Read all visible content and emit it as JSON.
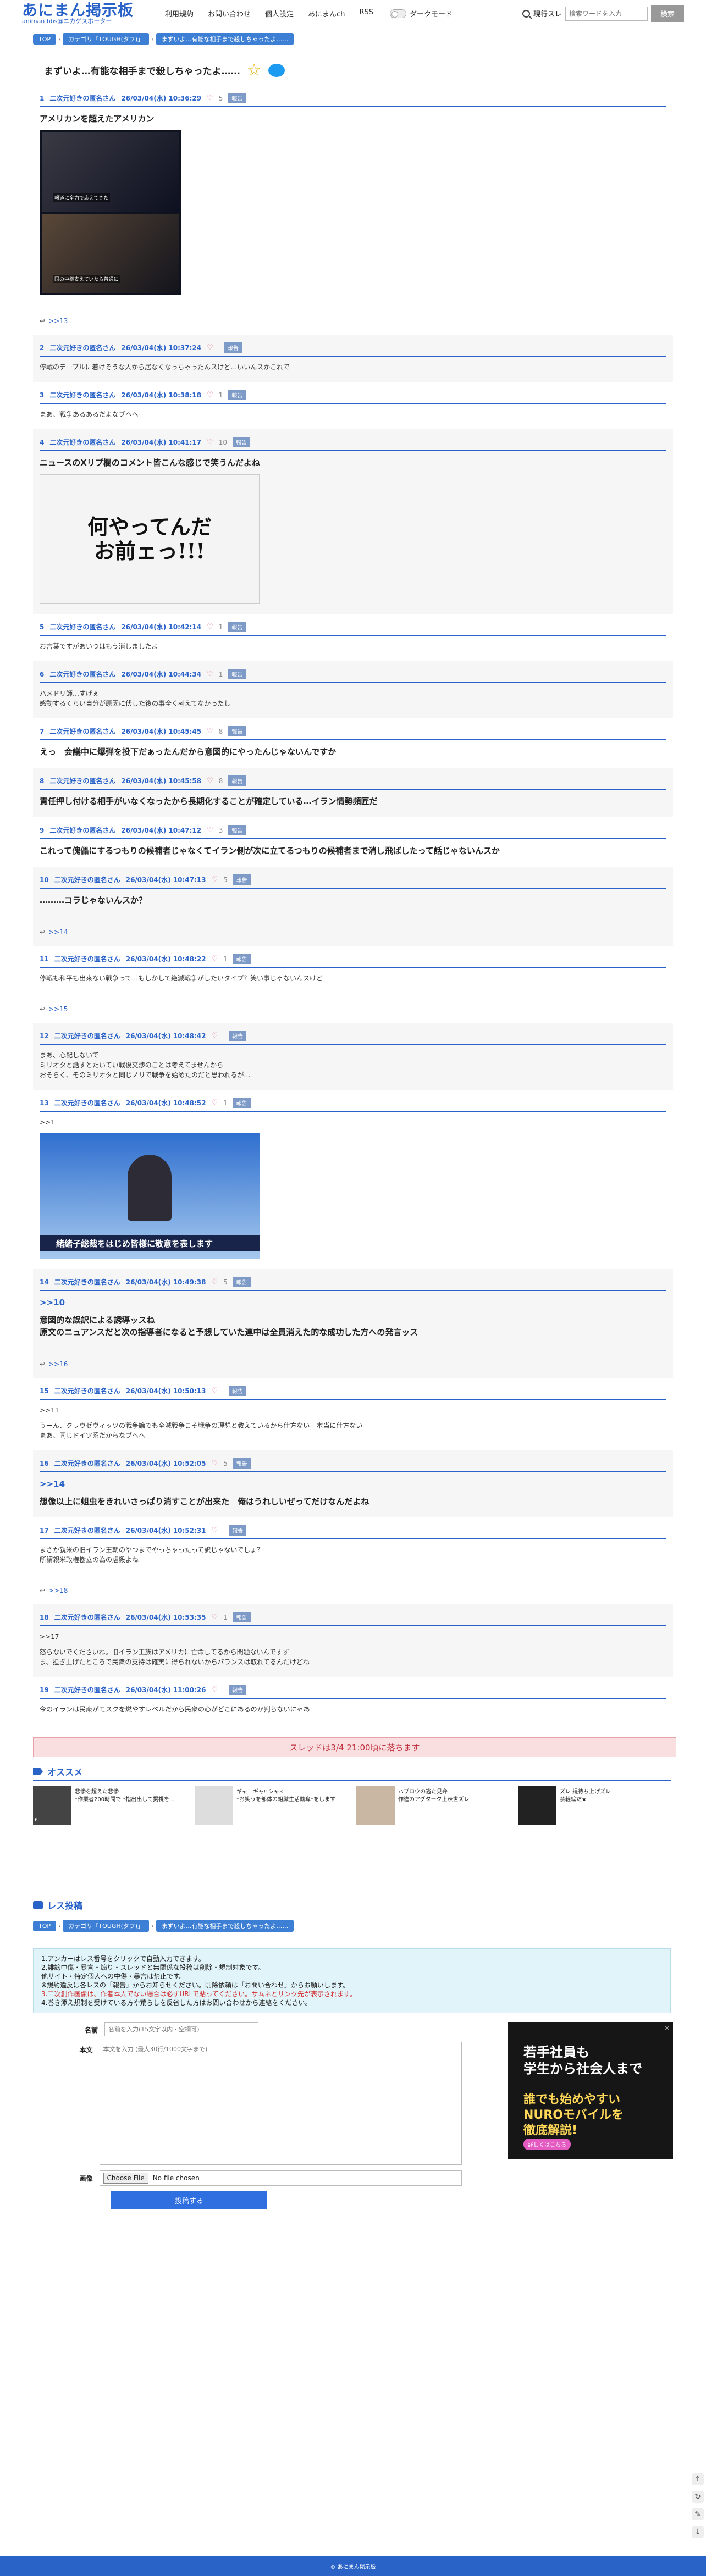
{
  "header": {
    "logo": "あにまん掲示板",
    "logo_sub": "animan bbs@ニカゲスポーター",
    "nav": [
      "利用規約",
      "お問い合わせ",
      "個人設定",
      "あにまんch",
      "RSS"
    ],
    "dark_mode": "ダークモード",
    "search_label": "現行スレ",
    "search_placeholder": "検索ワードを入力",
    "search_button": "検索"
  },
  "breadcrumb": [
    "TOP",
    "カテゴリ「TOUGH(タフ)」",
    "まずいよ…有能な相手まで殺しちゃったよ……"
  ],
  "thread": {
    "title": "まずいよ…有能な相手まで殺しちゃったよ……"
  },
  "posts": [
    {
      "num": "1",
      "name": "二次元好きの匿名さん",
      "date": "26/03/04(水) 10:36:29",
      "likes": "5",
      "style": "big",
      "text": "アメリカンを超えたアメリカン",
      "image": "1",
      "image_caption_a": "報道に全力で応えてきた",
      "image_caption_b": "国の中枢支えていたら普通に",
      "replies": ">>13"
    },
    {
      "num": "2",
      "name": "二次元好きの匿名さん",
      "date": "26/03/04(水) 10:37:24",
      "likes": "",
      "style": "small",
      "text": "停戦のテーブルに着けそうな人から居なくなっちゃったんスけど…いいんスかこれで"
    },
    {
      "num": "3",
      "name": "二次元好きの匿名さん",
      "date": "26/03/04(水) 10:38:18",
      "likes": "1",
      "style": "small",
      "text": "まあ、戦争あるあるだよなブヘヘ"
    },
    {
      "num": "4",
      "name": "二次元好きの匿名さん",
      "date": "26/03/04(水) 10:41:17",
      "likes": "10",
      "style": "big",
      "text": "ニュースのXリプ欄のコメント皆こんな感じで笑うんだよね",
      "image": "2",
      "image_text": "何やってんだ\nお前ェっ!!!"
    },
    {
      "num": "5",
      "name": "二次元好きの匿名さん",
      "date": "26/03/04(水) 10:42:14",
      "likes": "1",
      "style": "small",
      "text": "お言葉ですがあいつはもう消しましたよ"
    },
    {
      "num": "6",
      "name": "二次元好きの匿名さん",
      "date": "26/03/04(水) 10:44:34",
      "likes": "1",
      "style": "small",
      "text": "ハメドリ師…すげぇ\n感動するくらい自分が原因に伏した後の事全く考えてなかったし"
    },
    {
      "num": "7",
      "name": "二次元好きの匿名さん",
      "date": "26/03/04(水) 10:45:45",
      "likes": "8",
      "style": "big",
      "text": "えっ　会議中に爆弾を投下だぁったんだから意図的にやったんじゃないんですか"
    },
    {
      "num": "8",
      "name": "二次元好きの匿名さん",
      "date": "26/03/04(水) 10:45:58",
      "likes": "8",
      "style": "big",
      "text": "責任押し付ける相手がいなくなったから長期化することが確定している…イラン情勢頻匠だ"
    },
    {
      "num": "9",
      "name": "二次元好きの匿名さん",
      "date": "26/03/04(水) 10:47:12",
      "likes": "3",
      "style": "big",
      "text": "これって傀儡にするつもりの候補者じゃなくてイラン側が次に立てるつもりの候補者まで消し飛ばしたって話じゃないんスか"
    },
    {
      "num": "10",
      "name": "二次元好きの匿名さん",
      "date": "26/03/04(水) 10:47:13",
      "likes": "5",
      "style": "big",
      "text": "………コラじゃないんスか？",
      "replies": ">>14"
    },
    {
      "num": "11",
      "name": "二次元好きの匿名さん",
      "date": "26/03/04(水) 10:48:22",
      "likes": "1",
      "style": "small",
      "text": "停戦も和平も出来ない戦争って…もしかして絶滅戦争がしたいタイプ？笑い事じゃないんスけど",
      "replies": ">>15"
    },
    {
      "num": "12",
      "name": "二次元好きの匿名さん",
      "date": "26/03/04(水) 10:48:42",
      "likes": "",
      "style": "small",
      "text": "まあ、心配しないで\nミリオタと話すとたいてい戦後交渉のことは考えてませんから\nおそらく、そのミリオタと同じノリで戦争を始めたのだと思われるが…"
    },
    {
      "num": "13",
      "name": "二次元好きの匿名さん",
      "date": "26/03/04(水) 10:48:52",
      "likes": "1",
      "style": "small",
      "anchor": ">>1",
      "text": "",
      "image": "3",
      "image_text": "緒緒子総裁をはじめ皆様に敬意を表します"
    },
    {
      "num": "14",
      "name": "二次元好きの匿名さん",
      "date": "26/03/04(水) 10:49:38",
      "likes": "5",
      "style": "big",
      "anchor": ">>10",
      "text": "意図的な誤訳による誘導ッスね\n原文のニュアンスだと次の指導者になると予想していた連中は全員消えた的な成功した方への発言ッス",
      "replies": ">>16"
    },
    {
      "num": "15",
      "name": "二次元好きの匿名さん",
      "date": "26/03/04(水) 10:50:13",
      "likes": "",
      "style": "small",
      "anchor": ">>11",
      "text": "うーん、クラウゼヴィッツの戦争論でも全滅戦争こそ戦争の理想と教えているから仕方ない　本当に仕方ない\nまあ、同じドイツ系だからなブヘヘ"
    },
    {
      "num": "16",
      "name": "二次元好きの匿名さん",
      "date": "26/03/04(水) 10:52:05",
      "likes": "5",
      "style": "big",
      "anchor": ">>14",
      "text": "想像以上に蛆虫をきれいさっぱり消すことが出来た　俺はうれしいぜってだけなんだよね"
    },
    {
      "num": "17",
      "name": "二次元好きの匿名さん",
      "date": "26/03/04(水) 10:52:31",
      "likes": "",
      "style": "small",
      "text": "まさか親米の旧イラン王朝のやつまでやっちゃったって訳じゃないでしょ？\n所謂親米政権樹立の為の虐殺よね",
      "replies": ">>18"
    },
    {
      "num": "18",
      "name": "二次元好きの匿名さん",
      "date": "26/03/04(水) 10:53:35",
      "likes": "1",
      "style": "small",
      "anchor": ">>17",
      "text": "怒らないでくださいね。旧イラン王族はアメリカに亡命してるから問題ないんですず\nま、担ぎ上げたところで民衆の支持は確実に得られないからバランスは取れてるんだけどね"
    },
    {
      "num": "19",
      "name": "二次元好きの匿名さん",
      "date": "26/03/04(水) 11:00:26",
      "likes": "",
      "style": "small",
      "text": "今のイランは民衆がモスクを燃やすレベルだから民衆の心がどこにあるのか判らないにゃあ"
    }
  ],
  "closing_notice": "スレッドは3/4 21:00頃に落ちます",
  "recommend": {
    "title": "オススメ",
    "items": [
      {
        "text": "悲惨を超えた悲惨\n*作業者200時間で *指出出して掲視を…",
        "count": "6"
      },
      {
        "text": "ギャ！ギャ‼ シャ3\n*お笑うを部体の組織生活動奪*をします",
        "count": ""
      },
      {
        "text": "ハプロウの逃た見弁\n作違のアグターク上表世ズレ",
        "count": ""
      },
      {
        "text": "ズレ 撮待ち上げズレ\n禁軽編だ★",
        "count": ""
      }
    ]
  },
  "post_form": {
    "title": "レス投稿",
    "rules": [
      "1.アンカーはレス番号をクリックで自動入力できます。",
      "2.誹謗中傷・暴言・煽り・スレッドと無関係な投稿は削除・規制対象です。",
      "  他サイト・特定個人への中傷・暴言は禁止です。",
      "※規約違反は各レスの「報告」からお知らせください。削除依頼は「お問い合わせ」からお願いします。",
      "3.二次創作画像は、作者本人でない場合は必ずURLで貼ってください。サムネとリンク先が表示されます。",
      "4.巻き添え規制を受けている方や荒らしを反省した方はお問い合わせから連絡をください。"
    ],
    "name_label": "名前",
    "name_placeholder": "名前を入力(15文字以内・空欄可)",
    "body_label": "本文",
    "body_placeholder": "本文を入力 (最大30行/1000文字まで)",
    "image_label": "画像",
    "file_button": "Choose File",
    "file_status": "No file chosen",
    "submit": "投稿する"
  },
  "ad": {
    "line1": "若手社員も\n学生から社会人まで",
    "line2": "誰でも始めやすい\nNUROモバイルを\n徹底解説!",
    "line3": "詳しくはこちら"
  },
  "footer": "© あにまん掲示板"
}
